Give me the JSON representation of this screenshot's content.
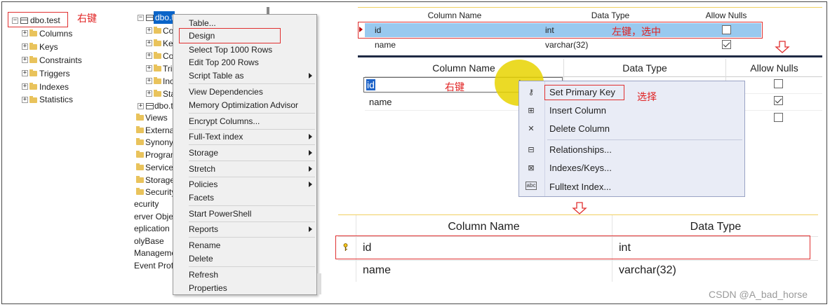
{
  "tree": {
    "root_label": "dbo.test",
    "annotation": "右键",
    "children": [
      "Columns",
      "Keys",
      "Constraints",
      "Triggers",
      "Indexes",
      "Statistics"
    ]
  },
  "tree2": {
    "selected_label": "dbo.t",
    "sub_partial": [
      "Co",
      "Ke",
      "Co",
      "Tri",
      "Inc",
      "Sta"
    ],
    "next_table": "dbo.t",
    "folders": [
      "Views",
      "External",
      "Synony",
      "Program",
      "Service",
      "Storage",
      "Security"
    ],
    "outer": [
      "ecurity",
      "erver Objec",
      "eplication",
      "olyBase",
      "Managemen",
      "Event Profi"
    ]
  },
  "context_menu": {
    "items": [
      {
        "label": "Table...",
        "submenu": false
      },
      {
        "label": "Design",
        "submenu": false
      },
      {
        "label": "Select Top 1000 Rows",
        "submenu": false
      },
      {
        "label": "Edit Top 200 Rows",
        "submenu": false
      },
      {
        "label": "Script Table as",
        "submenu": true
      },
      {
        "label": "View Dependencies",
        "submenu": false
      },
      {
        "label": "Memory Optimization Advisor",
        "submenu": false
      },
      {
        "label": "Encrypt Columns...",
        "submenu": false
      },
      {
        "label": "Full-Text index",
        "submenu": true
      },
      {
        "label": "Storage",
        "submenu": true
      },
      {
        "label": "Stretch",
        "submenu": true
      },
      {
        "label": "Policies",
        "submenu": true
      },
      {
        "label": "Facets",
        "submenu": false
      },
      {
        "label": "Start PowerShell",
        "submenu": false
      },
      {
        "label": "Reports",
        "submenu": true
      },
      {
        "label": "Rename",
        "submenu": false
      },
      {
        "label": "Delete",
        "submenu": false
      },
      {
        "label": "Refresh",
        "submenu": false
      },
      {
        "label": "Properties",
        "submenu": false
      }
    ]
  },
  "grid1": {
    "headers": [
      "Column Name",
      "Data Type",
      "Allow Nulls"
    ],
    "rows": [
      {
        "name": "id",
        "type": "int",
        "allow_nulls": false
      },
      {
        "name": "name",
        "type": "varchar(32)",
        "allow_nulls": true
      }
    ],
    "annotation": "左键，选中"
  },
  "grid2": {
    "headers": [
      "Column Name",
      "Data Type",
      "Allow Nulls"
    ],
    "rows": [
      {
        "name": "id",
        "allow_nulls": false
      },
      {
        "name": "name",
        "allow_nulls": true
      },
      {
        "name": "",
        "allow_nulls": false
      }
    ],
    "annotation_rightclick": "右键",
    "annotation_select": "选择"
  },
  "context_menu2": {
    "items": [
      {
        "label": "Set Primary Key",
        "icon": "primary-key-icon"
      },
      {
        "label": "Insert Column",
        "icon": "insert-column-icon"
      },
      {
        "label": "Delete Column",
        "icon": "delete-column-icon"
      },
      {
        "label": "Relationships...",
        "icon": "relationships-icon"
      },
      {
        "label": "Indexes/Keys...",
        "icon": "indexes-keys-icon"
      },
      {
        "label": "Fulltext Index...",
        "icon": "fulltext-index-icon"
      }
    ]
  },
  "grid3": {
    "headers": [
      "Column Name",
      "Data Type"
    ],
    "rows": [
      {
        "name": "id",
        "type": "int",
        "key": true
      },
      {
        "name": "name",
        "type": "varchar(32)",
        "key": false
      }
    ]
  },
  "watermark": "CSDN @A_bad_horse",
  "colors": {
    "annotation": "#e02020",
    "selection": "#0078d7",
    "row_highlight": "#99c9ef",
    "menu_bg": "#f0f0f0",
    "ctx2_bg": "#e9ecf6",
    "header_line": "#f0d060"
  }
}
